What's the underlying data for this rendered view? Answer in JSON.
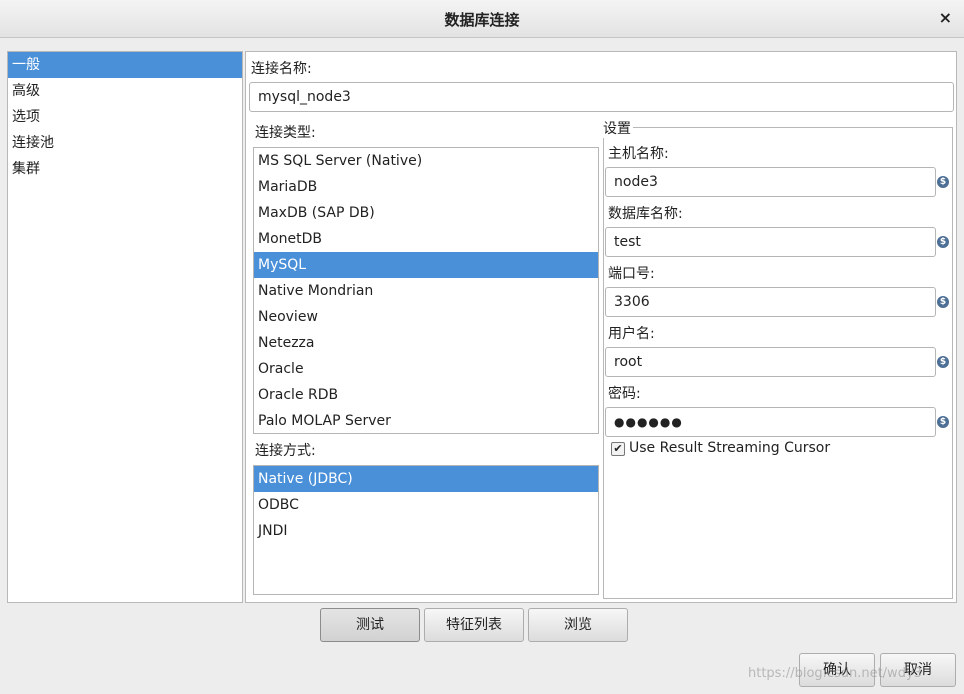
{
  "window": {
    "title": "数据库连接",
    "close": "×"
  },
  "nav": {
    "items": [
      "一般",
      "高级",
      "选项",
      "连接池",
      "集群"
    ]
  },
  "general": {
    "conn_name_label": "连接名称:",
    "conn_name_value": "mysql_node3",
    "conn_type_label": "连接类型:",
    "conn_types": [
      "MS SQL Server (Native)",
      "MariaDB",
      "MaxDB (SAP DB)",
      "MonetDB",
      "MySQL",
      "Native Mondrian",
      "Neoview",
      "Netezza",
      "Oracle",
      "Oracle RDB",
      "Palo MOLAP Server"
    ],
    "conn_type_selected": "MySQL",
    "access_label": "连接方式:",
    "access_types": [
      "Native (JDBC)",
      "ODBC",
      "JNDI"
    ],
    "access_selected": "Native (JDBC)"
  },
  "settings": {
    "title": "设置",
    "host_label": "主机名称:",
    "host_value": "node3",
    "db_label": "数据库名称:",
    "db_value": "test",
    "port_label": "端口号:",
    "port_value": "3306",
    "user_label": "用户名:",
    "user_value": "root",
    "password_label": "密码:",
    "password_value": "●●●●●●",
    "streaming_label": "Use Result Streaming Cursor",
    "streaming_checked": true,
    "var_icon": "variable-icon"
  },
  "buttons": {
    "test": "测试",
    "features": "特征列表",
    "explore": "浏览",
    "ok": "确认",
    "cancel": "取消"
  },
  "watermark": "https://blog.csdn.net/wdy3"
}
